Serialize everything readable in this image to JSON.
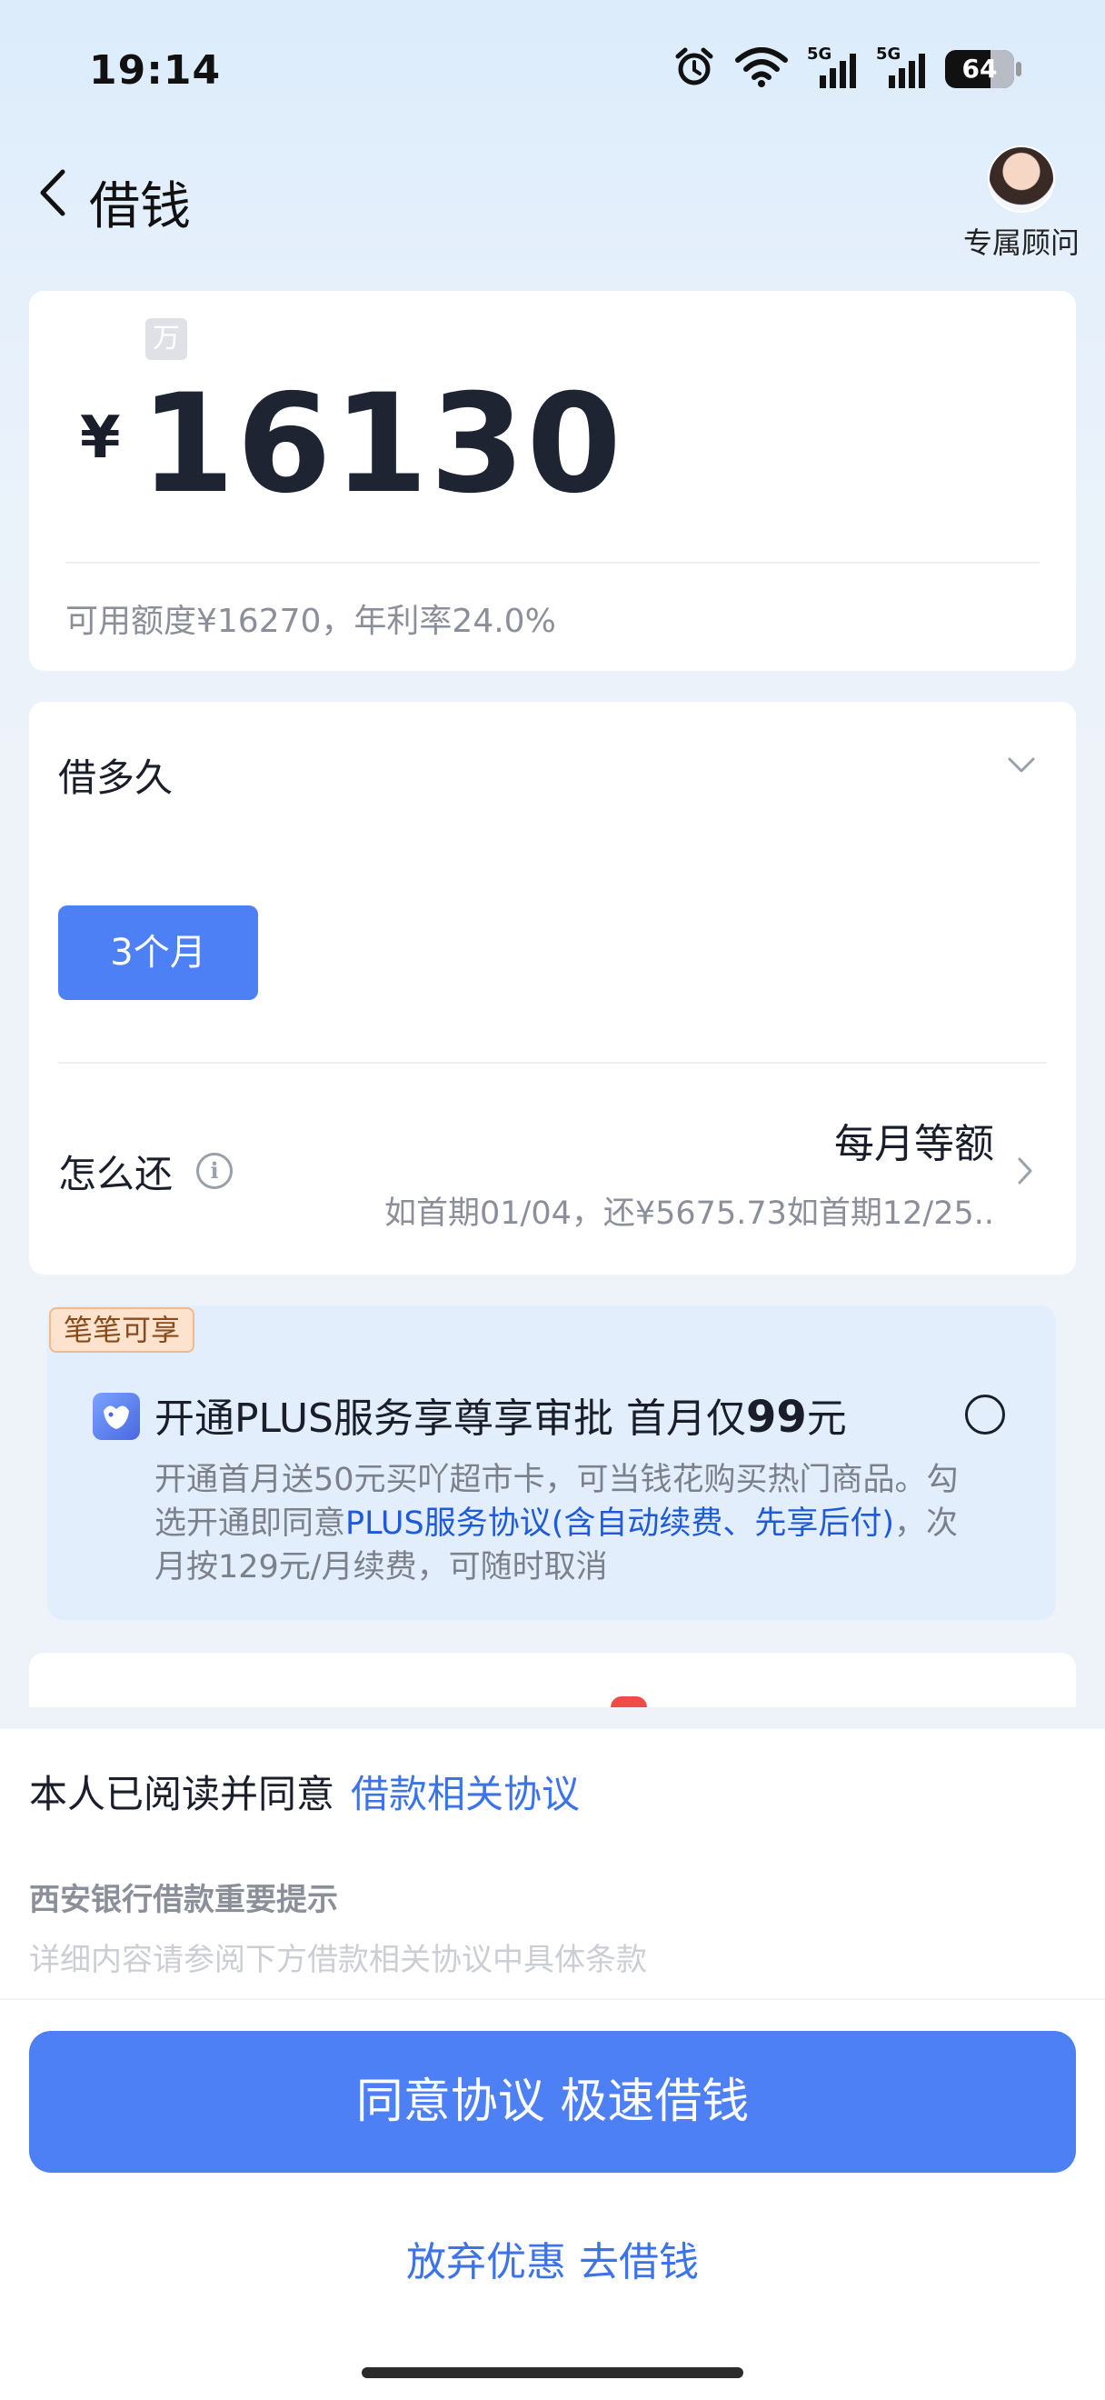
{
  "status_bar": {
    "time": "19:14",
    "battery": "64",
    "icons": [
      "alarm-icon",
      "wifi-icon",
      "signal-5g-icon",
      "signal-5g-icon",
      "battery-icon"
    ],
    "signal_label_1": "5G",
    "signal_label_2": "5G"
  },
  "header": {
    "title": "借钱",
    "advisor_label": "专属顾问"
  },
  "amount_card": {
    "unit_tag": "万",
    "currency": "¥",
    "amount": "16130",
    "limit_info": "可用额度¥16270，年利率24.0%"
  },
  "term_card": {
    "title": "借多久",
    "selected_term": "3个月",
    "repay_label": "怎么还",
    "repay_method": "每月等额",
    "repay_detail": "如首期01/04，还¥5675.73如首期12/25.."
  },
  "plus_card": {
    "badge": "笔笔可享",
    "title_main": "开通PLUS服务享尊享审批  首月仅",
    "title_price": "99",
    "title_unit": "元",
    "desc_part1": "开通首月送50元买吖超市卡，可当钱花购买热门商品。勾选开通即同意",
    "desc_link": "PLUS服务协议(含自动续费、先享后付)",
    "desc_part2": "，次月按129元/月续费，可随时取消",
    "checked": false
  },
  "bottom_sheet": {
    "agree_text": "本人已阅读并同意",
    "agree_link": "借款相关协议",
    "notice_title": "西安银行借款重要提示",
    "notice_text": "详细内容请参阅下方借款相关协议中具体条款",
    "primary_button": "同意协议 极速借钱",
    "secondary_link": "放弃优惠 去借钱"
  },
  "colors": {
    "accent": "#4e80f5",
    "link": "#3d73e8",
    "plus_bg": "#e3eefc",
    "badge_bg": "#fde3cd"
  }
}
